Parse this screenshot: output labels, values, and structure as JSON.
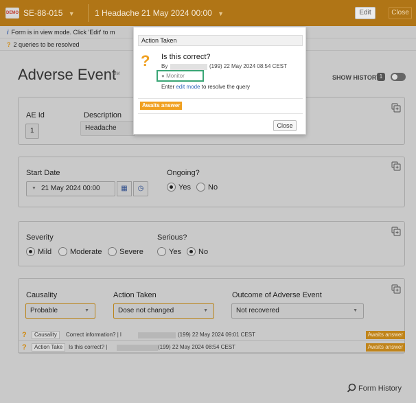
{
  "topbar": {
    "demo_badge": "DEMO",
    "subject": "SE-88-015",
    "event": "1 Headache 21 May 2024 00:00",
    "edit_label": "Edit",
    "close_label": "Close"
  },
  "info": {
    "view_mode_text": "Form is in view mode. Click 'Edit' to m",
    "queries_text": "2 queries to be resolved"
  },
  "page": {
    "title": "Adverse Event",
    "title_meta": "DM",
    "show_history": "SHOW HISTORY",
    "history_count": "1"
  },
  "cards": {
    "ae": {
      "id_label": "AE Id",
      "id_value": "1",
      "desc_label": "Description",
      "desc_value": "Headache"
    },
    "start": {
      "start_label": "Start Date",
      "start_value": "21 May 2024 00:00",
      "ongoing_label": "Ongoing?",
      "ongoing_options": [
        "Yes",
        "No"
      ],
      "ongoing_selected": "Yes"
    },
    "severity": {
      "severity_label": "Severity",
      "severity_options": [
        "Mild",
        "Moderate",
        "Severe"
      ],
      "severity_selected": "Mild",
      "serious_label": "Serious?",
      "serious_options": [
        "Yes",
        "No"
      ],
      "serious_selected": "No"
    },
    "causality": {
      "causality_label": "Causality",
      "causality_value": "Probable",
      "action_label": "Action Taken",
      "action_value": "Dose not changed",
      "outcome_label": "Outcome of Adverse Event",
      "outcome_value": "Not recovered"
    }
  },
  "queries": [
    {
      "field": "Causality",
      "text": "Correct information? | l",
      "meta": "(199) 22 May 2024 09:01 CEST",
      "status": "Awaits answer"
    },
    {
      "field": "Action Take",
      "text": "Is this correct? |",
      "meta": "(199) 22 May 2024 08:54 CEST",
      "status": "Awaits answer"
    }
  ],
  "popup": {
    "header": "Action Taken",
    "question": "Is this correct?",
    "by": "By",
    "meta": "(199) 22 May 2024 08:54 CEST",
    "role": "Monitor",
    "enter_prefix": "Enter",
    "enter_link": "edit mode",
    "enter_suffix": "to resolve the query",
    "status": "Awaits answer",
    "close_label": "Close"
  },
  "footer": {
    "form_history": "Form History"
  },
  "colors": {
    "accent": "#b07516",
    "awaits": "#f0a020",
    "highlight": "#3aa676",
    "link": "#2f66b8"
  }
}
